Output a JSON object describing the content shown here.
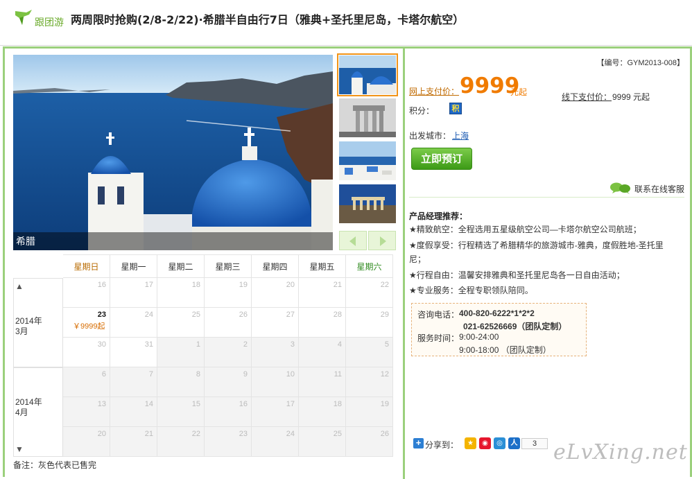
{
  "header": {
    "logo_text": "跟团游",
    "title": "两周限时抢购(2/8-2/22)·希腊半自由行7日（雅典+圣托里尼岛，卡塔尔航空）"
  },
  "gallery": {
    "caption": "希腊"
  },
  "calendar": {
    "weekdays": [
      "星期日",
      "星期一",
      "星期二",
      "星期三",
      "星期四",
      "星期五",
      "星期六"
    ],
    "months": [
      {
        "label_year": "2014年",
        "label_month": "3月"
      },
      {
        "label_year": "2014年",
        "label_month": "4月"
      }
    ],
    "up_arrow": "▲",
    "down_arrow": "▼",
    "weeks": [
      [
        "16",
        "17",
        "18",
        "19",
        "20",
        "21",
        "22"
      ],
      [
        "23",
        "24",
        "25",
        "26",
        "27",
        "28",
        "29"
      ],
      [
        "30",
        "31",
        "1",
        "2",
        "3",
        "4",
        "5"
      ],
      [
        "6",
        "7",
        "8",
        "9",
        "10",
        "11",
        "12"
      ],
      [
        "13",
        "14",
        "15",
        "16",
        "17",
        "18",
        "19"
      ],
      [
        "20",
        "21",
        "22",
        "23",
        "24",
        "25",
        "26"
      ]
    ],
    "available_price": "￥9999起",
    "note": "备注：灰色代表已售完"
  },
  "product": {
    "code": "【编号：GYM2013-008】",
    "online_label": "网上支付价：",
    "online_price": "9999",
    "online_unit": "元起",
    "offline_label": "线下支付价：",
    "offline_value": "9999 元起",
    "points_label": "积分：",
    "points_badge": "积",
    "depart_label": "出发城市：",
    "depart_city": "上海",
    "book_button": "立即预订",
    "support_link": "联系在线客服"
  },
  "recommend": {
    "title": "产品经理推荐：",
    "items": [
      "★精致航空：全程选用五星级航空公司—卡塔尔航空公司航班；",
      "★度假享受：行程精选了希腊精华的旅游城市-雅典，度假胜地-圣托里尼；",
      "★行程自由：温馨安排雅典和圣托里尼岛各一日自由活动；",
      "★专业服务：全程专职领队陪同。"
    ]
  },
  "contact": {
    "phone_label": "咨询电话：",
    "phone1": "400-820-6222*1*2*2",
    "phone2": "021-62526669（团队定制）",
    "hours_label": "服务时间：",
    "hours1": "9:00-24:00",
    "hours2": "9:00-18:00 （团队定制）"
  },
  "share": {
    "label": "分享到：",
    "plus": "+",
    "count": "3",
    "icons": [
      "qzone-icon",
      "weibo-icon",
      "tqq-icon",
      "renren-icon"
    ]
  },
  "watermark": "eLvXing.net"
}
